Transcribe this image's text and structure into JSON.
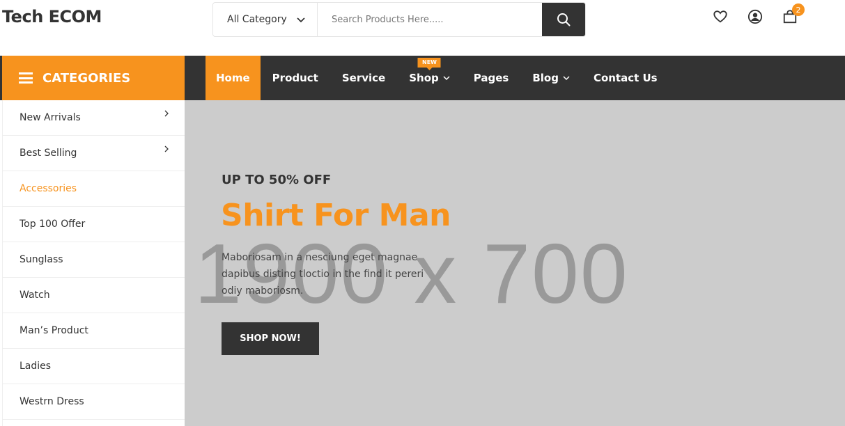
{
  "header": {
    "logo": "Tech ECOM",
    "category_select": "All Category",
    "search_placeholder": "Search Products Here.....",
    "cart_count": "2"
  },
  "icons": {
    "chevron": "chevron-down-icon",
    "search": "search-icon",
    "wishlist": "heart-icon",
    "account": "user-icon",
    "cart": "shopping-bag-icon",
    "menu": "hamburger-icon"
  },
  "colors": {
    "accent": "#f7931e",
    "dark": "#333333",
    "hero_bg": "#cccccc"
  },
  "navbar": {
    "categories_label": "CATEGORIES",
    "menu": [
      {
        "label": "Home",
        "active": true
      },
      {
        "label": "Product"
      },
      {
        "label": "Service"
      },
      {
        "label": "Shop",
        "badge": "NEW",
        "dropdown": true
      },
      {
        "label": "Pages"
      },
      {
        "label": "Blog",
        "dropdown": true
      },
      {
        "label": "Contact Us"
      }
    ]
  },
  "sidebar": {
    "items": [
      {
        "label": "New Arrivals",
        "has_sub": true
      },
      {
        "label": "Best Selling",
        "has_sub": true
      },
      {
        "label": "Accessories",
        "active": true
      },
      {
        "label": "Top 100 Offer"
      },
      {
        "label": "Sunglass"
      },
      {
        "label": "Watch"
      },
      {
        "label": "Man’s Product"
      },
      {
        "label": "Ladies"
      },
      {
        "label": "Westrn Dress"
      }
    ]
  },
  "hero": {
    "placeholder_text": "1900 x 700",
    "subtitle": "UP TO 50% OFF",
    "title": "Shirt For Man",
    "description": "Maboriosam in a nesciung eget magnae dapibus disting tloctio in the find it pereri odiy maboriosm.",
    "button": "SHOP NOW!"
  }
}
